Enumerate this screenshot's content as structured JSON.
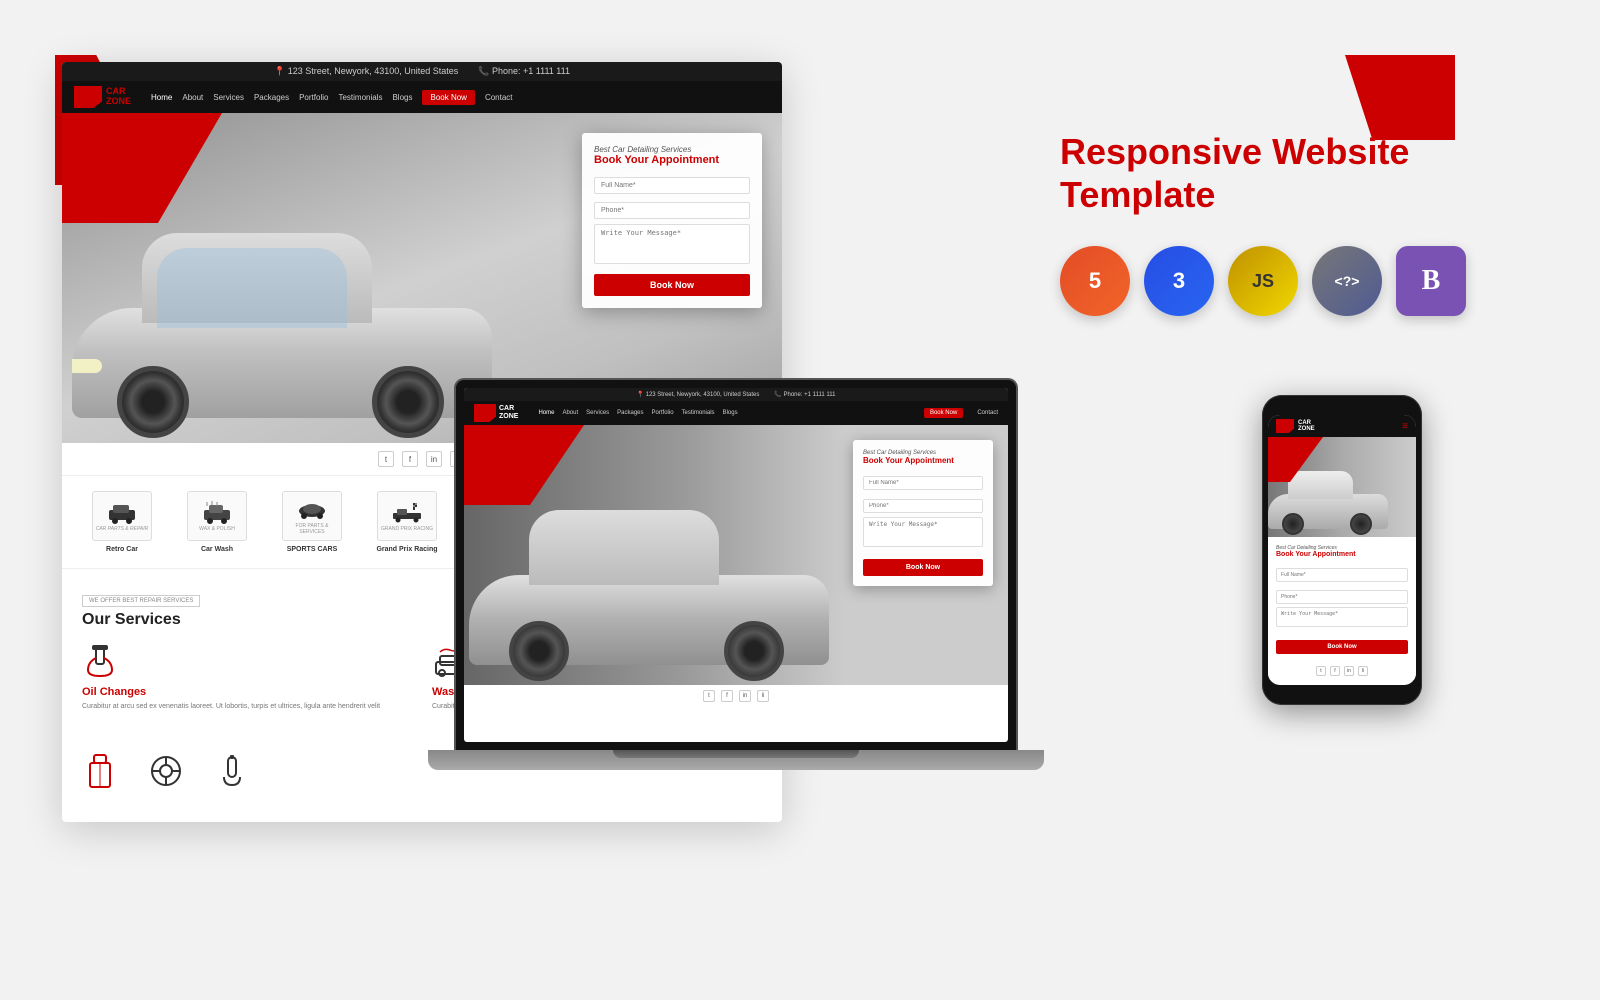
{
  "page": {
    "background": "#f2f2f2",
    "title": "Responsive Website Template"
  },
  "right_panel": {
    "heading": "Responsive Website Template",
    "tech_badges": [
      {
        "id": "html5",
        "label": "HTML5",
        "symbol": "5",
        "class": "html"
      },
      {
        "id": "css3",
        "label": "CSS3",
        "symbol": "3",
        "class": "css"
      },
      {
        "id": "js",
        "label": "JavaScript",
        "symbol": "JS",
        "class": "js"
      },
      {
        "id": "php",
        "label": "PHP",
        "symbol": "<?>",
        "class": "php"
      },
      {
        "id": "bootstrap",
        "label": "Bootstrap",
        "symbol": "B",
        "class": "bootstrap"
      }
    ]
  },
  "site": {
    "logo_line1": "CAR",
    "logo_line2": "ZONE",
    "info_bar": {
      "address": "📍 123 Street, Newyork, 43100, United States",
      "phone": "📞 Phone: +1 1111 111"
    },
    "nav": {
      "items": [
        "Home",
        "About",
        "Services",
        "Packages",
        "Portfolio",
        "Testimonials",
        "Blogs",
        "Book Now",
        "Contact"
      ]
    },
    "hero": {
      "subtitle": "Best Car Detailing Services",
      "title": "Book Your Appointment",
      "form": {
        "full_name_placeholder": "Full Name*",
        "phone_placeholder": "Phone*",
        "message_placeholder": "Write Your Message*",
        "book_btn": "Book Now"
      },
      "social": [
        "t",
        "f",
        "in",
        "li"
      ]
    },
    "brands": [
      {
        "name": "Retro Car",
        "tag": "CAR PARTS & REPAIR SERVICES"
      },
      {
        "name": "Car Wash",
        "tag": "WAX & POLISH"
      },
      {
        "name": "Sports Cars",
        "tag": "FOR PARTS & SERVICES"
      },
      {
        "name": "Grand Prix Racing",
        "tag": ""
      },
      {
        "name": "",
        "tag": ""
      }
    ],
    "services": {
      "tag": "WE OFFER BEST REPAIR SERVICES",
      "heading": "Our Services",
      "items": [
        {
          "name": "Oil Changes",
          "desc": "Curabitur at arcu sed ex venenatis laoreet. Ut lobortis, turpis et ultrices, ligula ante hendrerit velit"
        },
        {
          "name": "Wash & Clean",
          "desc": "Curabitur at arcu sed ex venenatis laoreet. Ut lobortis, turpis et ultrices, ligula ante hendrerit velit"
        }
      ]
    }
  }
}
